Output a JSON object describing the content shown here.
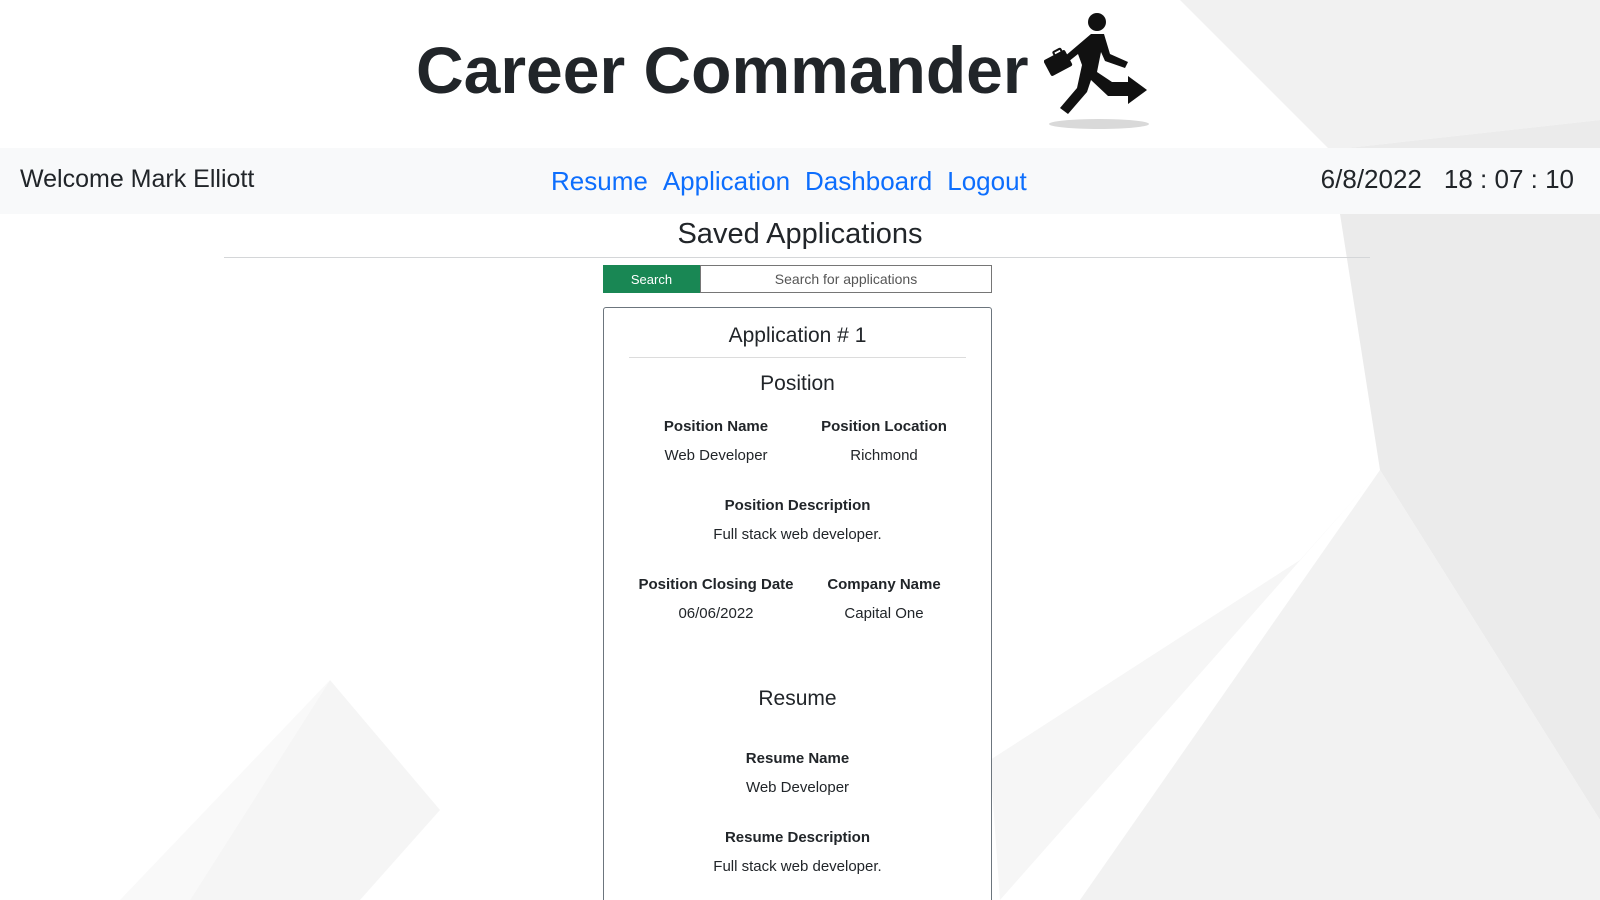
{
  "header": {
    "title": "Career Commander",
    "logo_icon": "running-businessman-icon"
  },
  "navbar": {
    "welcome": "Welcome Mark Elliott",
    "links": [
      "Resume",
      "Application",
      "Dashboard",
      "Logout"
    ],
    "date": "6/8/2022",
    "time": "18 : 07 : 10"
  },
  "main": {
    "title": "Saved Applications",
    "search": {
      "button_label": "Search",
      "placeholder": "Search for applications",
      "value": ""
    }
  },
  "application": {
    "title": "Application # 1",
    "position": {
      "heading": "Position",
      "name_label": "Position Name",
      "name_value": "Web Developer",
      "location_label": "Position Location",
      "location_value": "Richmond",
      "description_label": "Position Description",
      "description_value": "Full stack web developer.",
      "closing_label": "Position Closing Date",
      "closing_value": "06/06/2022",
      "company_label": "Company Name",
      "company_value": "Capital One"
    },
    "resume": {
      "heading": "Resume",
      "name_label": "Resume Name",
      "name_value": "Web Developer",
      "description_label": "Resume Description",
      "description_value": "Full stack web developer."
    }
  },
  "colors": {
    "link": "#0d6efd",
    "search_button": "#198754",
    "navbar_bg": "#f8f9fa",
    "text": "#212529"
  }
}
